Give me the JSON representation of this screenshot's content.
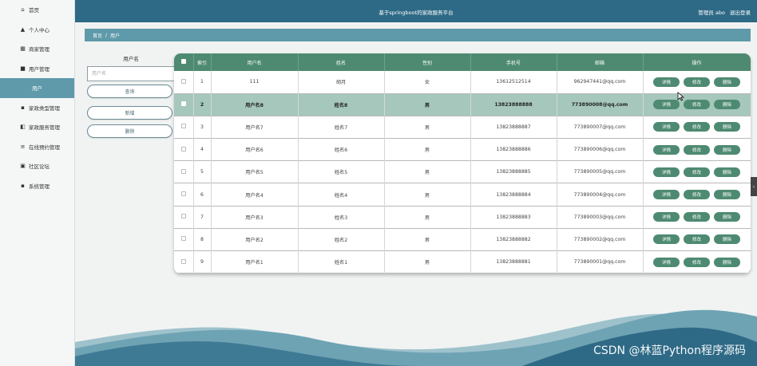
{
  "sidebar": {
    "items": [
      {
        "label": "首页",
        "icon": "home-icon",
        "glyph": "⌂"
      },
      {
        "label": "个人中心",
        "icon": "person-icon",
        "glyph": "▲"
      },
      {
        "label": "商家管理",
        "icon": "grid-icon",
        "glyph": "▦"
      },
      {
        "label": "用户管理",
        "icon": "doc-icon",
        "glyph": "■"
      },
      {
        "label": "用户",
        "icon": "",
        "glyph": ""
      },
      {
        "label": "家政类型管理",
        "icon": "apps-icon",
        "glyph": "▪"
      },
      {
        "label": "家政服务管理",
        "icon": "service-icon",
        "glyph": "◧"
      },
      {
        "label": "在线预约管理",
        "icon": "list-icon",
        "glyph": "≡"
      },
      {
        "label": "社区论坛",
        "icon": "forum-icon",
        "glyph": "▣"
      },
      {
        "label": "系统管理",
        "icon": "settings-icon",
        "glyph": "▪"
      }
    ]
  },
  "header": {
    "title": "基于springboot的家政服务平台",
    "user_label": "管理员 abo",
    "logout_label": "退出登录"
  },
  "breadcrumb": {
    "home": "首页",
    "separator": "/",
    "current": "用户"
  },
  "search": {
    "label": "用户名",
    "placeholder": "用户名",
    "query_label": "查询",
    "add_label": "新增",
    "delete_label": "删除"
  },
  "table": {
    "headers": [
      "",
      "索引",
      "用户名",
      "姓名",
      "性别",
      "手机号",
      "邮箱",
      "操作"
    ],
    "actions": {
      "detail": "详情",
      "edit": "修改",
      "delete": "删除"
    },
    "rows": [
      {
        "index": "1",
        "username": "111",
        "name": "胡月",
        "gender": "女",
        "phone": "13612512514",
        "email": "962947441@qq.com"
      },
      {
        "index": "2",
        "username": "用户名8",
        "name": "姓名8",
        "gender": "男",
        "phone": "13823888888",
        "email": "773890008@qq.com"
      },
      {
        "index": "3",
        "username": "用户名7",
        "name": "姓名7",
        "gender": "男",
        "phone": "13823888887",
        "email": "773890007@qq.com"
      },
      {
        "index": "4",
        "username": "用户名6",
        "name": "姓名6",
        "gender": "男",
        "phone": "13823888886",
        "email": "773890006@qq.com"
      },
      {
        "index": "5",
        "username": "用户名5",
        "name": "姓名5",
        "gender": "男",
        "phone": "13823888885",
        "email": "773890005@qq.com"
      },
      {
        "index": "6",
        "username": "用户名4",
        "name": "姓名4",
        "gender": "男",
        "phone": "13823888884",
        "email": "773890004@qq.com"
      },
      {
        "index": "7",
        "username": "用户名3",
        "name": "姓名3",
        "gender": "男",
        "phone": "13823888883",
        "email": "773890003@qq.com"
      },
      {
        "index": "8",
        "username": "用户名2",
        "name": "姓名2",
        "gender": "男",
        "phone": "13823888882",
        "email": "773890002@qq.com"
      },
      {
        "index": "9",
        "username": "用户名1",
        "name": "姓名1",
        "gender": "男",
        "phone": "13823888881",
        "email": "773890001@qq.com"
      }
    ]
  },
  "watermark": "CSDN @林蓝Python程序源码",
  "colors": {
    "header": "#2e6a86",
    "accent": "#5f9aaa",
    "table_header": "#4e8a72",
    "highlight_row": "#a6c7bc"
  }
}
